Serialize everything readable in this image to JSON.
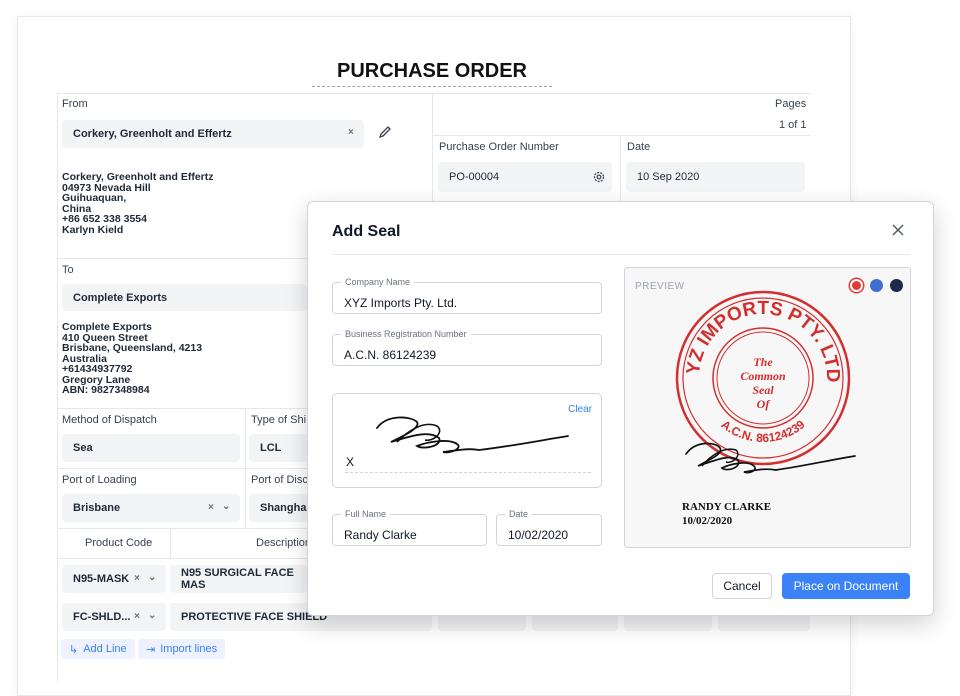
{
  "document": {
    "title": "PURCHASE ORDER",
    "from_label": "From",
    "from_value": "Corkery, Greenholt and Effertz",
    "from_address": [
      "Corkery, Greenholt and Effertz",
      "04973 Nevada Hill",
      "Guihuaquan,",
      "China",
      "+86 652 338 3554",
      "Karlyn Kield"
    ],
    "pages_label": "Pages",
    "pages_value": "1 of 1",
    "po_number_label": "Purchase Order Number",
    "po_number_value": "PO-00004",
    "date_label": "Date",
    "date_value": "10 Sep 2020",
    "to_label": "To",
    "to_value": "Complete Exports",
    "to_address": [
      "Complete Exports",
      "410 Queen Street",
      "Brisbane, Queensland, 4213",
      "Australia",
      "+61434937792",
      "Gregory Lane",
      "ABN: 9827348984"
    ],
    "dispatch_label": "Method of Dispatch",
    "dispatch_value": "Sea",
    "shipment_label": "Type of Shi",
    "shipment_value": "LCL",
    "loading_label": "Port of Loading",
    "loading_value": "Brisbane",
    "discharge_label": "Port of Disc",
    "discharge_value": "Shanghai",
    "columns": [
      "Product Code",
      "Description"
    ],
    "lines": [
      {
        "code": "N95-MASK",
        "description": "N95 SURGICAL FACE MAS"
      },
      {
        "code": "FC-SHLD...",
        "description": "PROTECTIVE FACE SHIELD"
      }
    ],
    "add_line": "Add Line",
    "import_lines": "Import lines"
  },
  "modal": {
    "title": "Add Seal",
    "company_label": "Company Name",
    "company_value": "XYZ Imports Pty. Ltd.",
    "brn_label": "Business Registration Number",
    "brn_value": "A.C.N. 86124239",
    "clear": "Clear",
    "sig_x": "X",
    "full_name_label": "Full Name",
    "full_name_value": "Randy Clarke",
    "date_label": "Date",
    "date_value": "10/02/2020",
    "preview_label": "PREVIEW",
    "seal_ring_text": "XYZ IMPORTS PTY. LTD.",
    "seal_acn": "A.C.N. 86124239",
    "seal_center": [
      "The",
      "Common",
      "Seal",
      "Of"
    ],
    "seal_signer": "RANDY CLARKE",
    "seal_date": "10/02/2020",
    "colors": [
      "#e53935",
      "#3f6fd1",
      "#1e2a4a"
    ],
    "cancel": "Cancel",
    "place": "Place on Document"
  }
}
